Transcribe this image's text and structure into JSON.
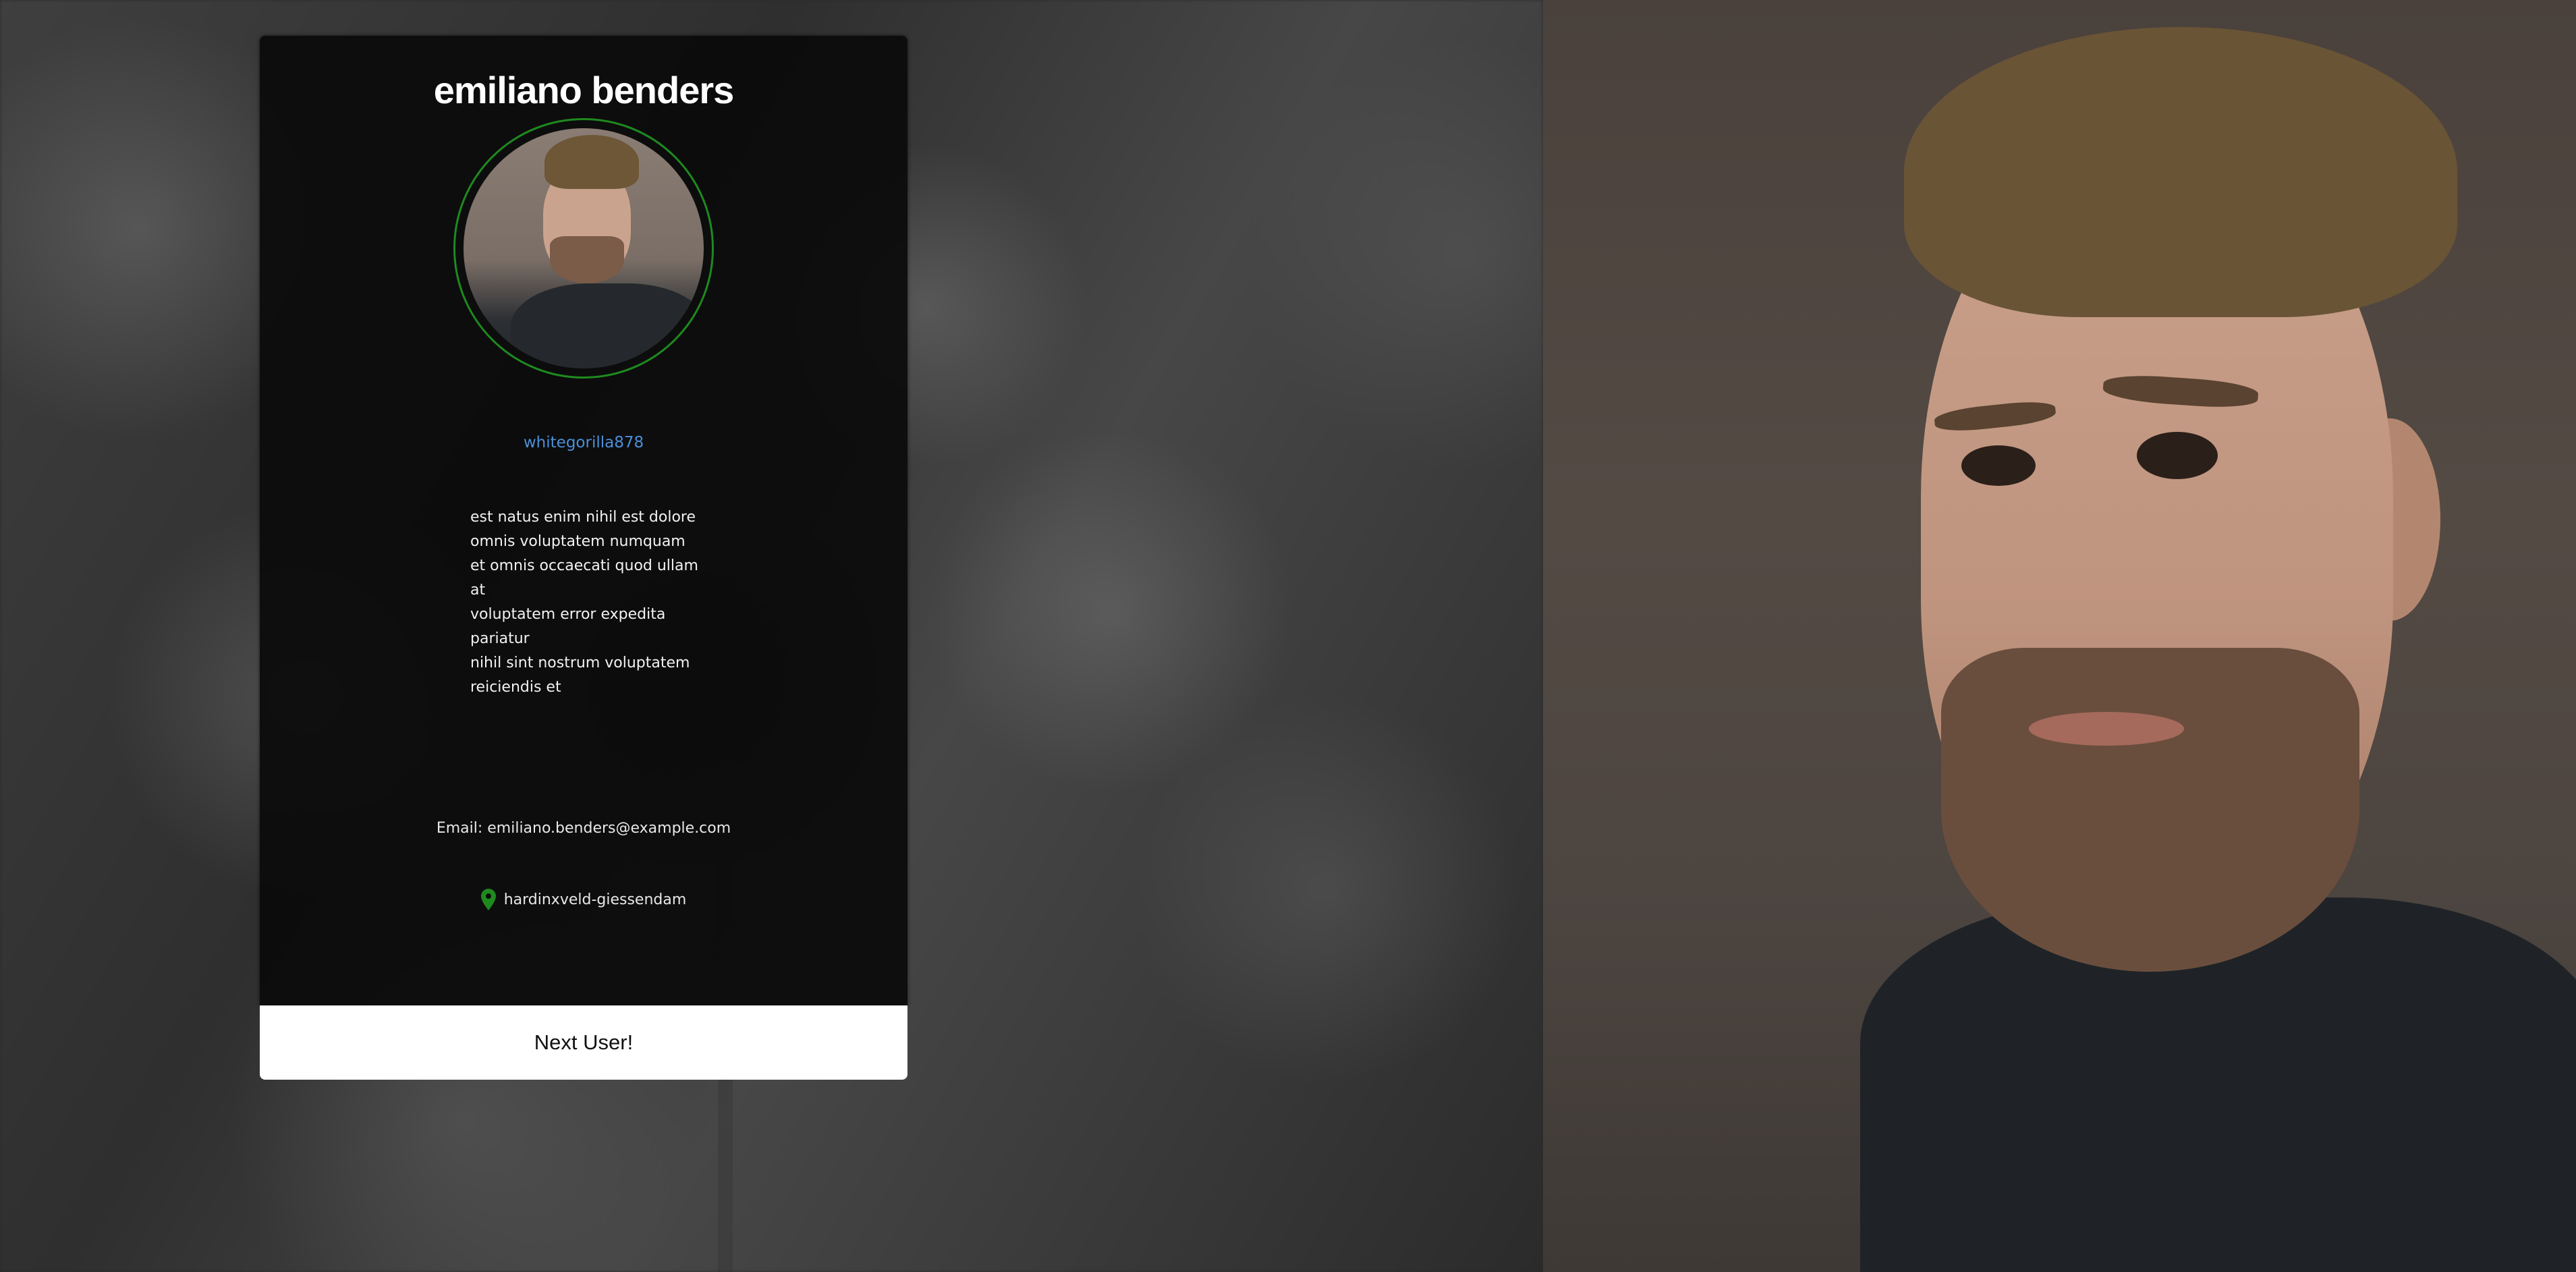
{
  "profile": {
    "name": "emiliano benders",
    "username": "whitegorilla878",
    "bio_lines": [
      "est natus enim nihil est dolore",
      "omnis voluptatem numquam",
      "et omnis occaecati quod ullam",
      "at",
      "voluptatem error expedita",
      "pariatur",
      "nihil sint nostrum voluptatem",
      "reiciendis et"
    ],
    "email": "Email: emiliano.benders@example.com",
    "location": "hardinxveld-giessendam"
  },
  "actions": {
    "next_label": "Next User!"
  },
  "icons": {
    "location": "map-pin-icon"
  },
  "colors": {
    "username_link": "#4a90d9",
    "avatar_ring": "#1e8a1e",
    "pin": "#1e8a1e"
  }
}
